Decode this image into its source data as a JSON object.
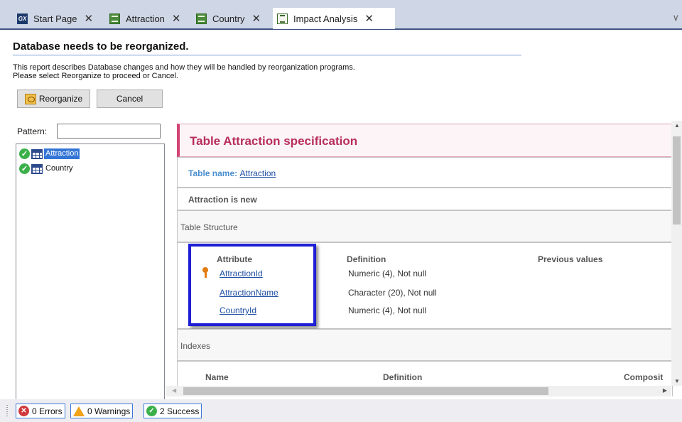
{
  "tabs": [
    {
      "label": "Start Page",
      "icon": "gx-logo-icon",
      "active": false
    },
    {
      "label": "Attraction",
      "icon": "table-object-icon",
      "active": false
    },
    {
      "label": "Country",
      "icon": "table-object-icon",
      "active": false
    },
    {
      "label": "Impact Analysis",
      "icon": "report-document-icon",
      "active": true
    }
  ],
  "tab_close_glyph": "✕",
  "tab_overflow_glyph": "∨",
  "header": {
    "title": "Database needs to be reorganized.",
    "description_line1": "This report describes Database changes and how they will be handled by reorganization programs.",
    "description_line2": "Please select Reorganize to proceed or Cancel."
  },
  "toolbar": {
    "reorganize_label": "Reorganize",
    "cancel_label": "Cancel"
  },
  "filter": {
    "pattern_label": "Pattern:",
    "pattern_value": ""
  },
  "tree": {
    "items": [
      {
        "label": "Attraction",
        "status": "success",
        "selected": true
      },
      {
        "label": "Country",
        "status": "success",
        "selected": false
      }
    ]
  },
  "report": {
    "spec_title": "Table Attraction specification",
    "table_name_label": "Table name:",
    "table_name_value": "Attraction",
    "is_new_text": "Attraction is new",
    "structure_heading": "Table Structure",
    "columns": {
      "attribute": "Attribute",
      "definition": "Definition",
      "previous_values": "Previous values"
    },
    "attributes": [
      {
        "name": "AttractionId",
        "definition": "Numeric (4), Not null",
        "key": true
      },
      {
        "name": "AttractionName",
        "definition": "Character (20), Not null",
        "key": false
      },
      {
        "name": "CountryId",
        "definition": "Numeric (4), Not null",
        "key": false
      }
    ],
    "indexes_heading": "Indexes",
    "index_columns": {
      "name": "Name",
      "definition": "Definition",
      "composition": "Composit"
    }
  },
  "status": {
    "errors": "0 Errors",
    "warnings": "0 Warnings",
    "success": "2 Success"
  },
  "colors": {
    "accent_pink": "#b72d5d",
    "link_blue": "#1f4fa3",
    "highlight_box": "#1f1fd6",
    "success_green": "#3bb04a",
    "error_red": "#d1383c",
    "warning_orange": "#f0a218"
  }
}
